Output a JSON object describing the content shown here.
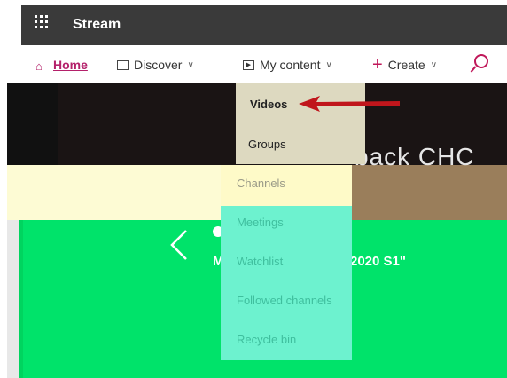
{
  "app": {
    "title": "Stream"
  },
  "nav": {
    "home": "Home",
    "discover": "Discover",
    "my_content": "My content",
    "create": "Create"
  },
  "menu": {
    "items": [
      "Videos",
      "Groups",
      "Channels",
      "Meetings",
      "Watchlist",
      "Followed channels",
      "Recycle bin"
    ]
  },
  "hero": {
    "title_fragment": "back CHC",
    "subtitle_fragment": "2020 S1\"",
    "subtitle_start": "M"
  },
  "colors": {
    "accent": "#c0185a",
    "topbar": "#3a3a3a",
    "highlight_green": "#00e36a",
    "menu_teal": "#6df2cf",
    "arrow_red": "#c0161c"
  },
  "icons": [
    "waffle-icon",
    "home-icon",
    "discover-icon",
    "my-content-icon",
    "plus-icon",
    "search-icon",
    "chevron-down-icon",
    "chevron-left-icon"
  ]
}
